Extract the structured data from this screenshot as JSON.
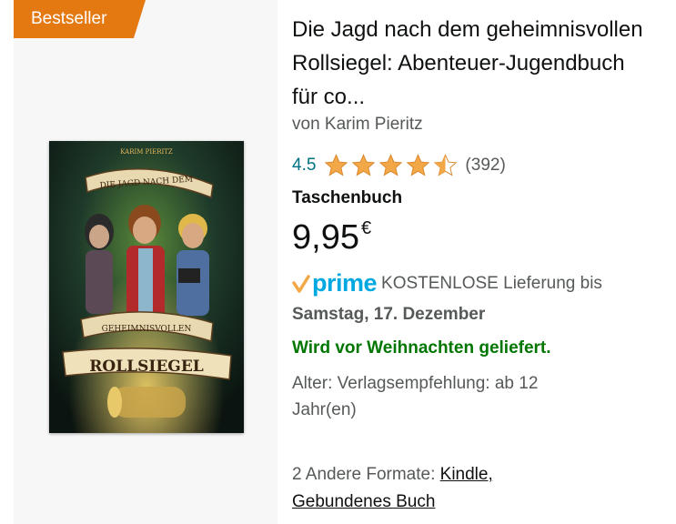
{
  "badge": {
    "label": "Bestseller"
  },
  "product": {
    "cover_image": "book-cover-image",
    "cover": {
      "author": "KARIM PIERITZ",
      "line1": "DIE JAGD NACH DEM",
      "line2": "GEHEIMNISVOLLEN",
      "line3": "ROLLSIEGEL"
    },
    "title": "Die Jagd nach dem geheimnisvollen Rollsiegel: Abenteuer-Jugendbuch für co...",
    "author": "von Karim Pieritz",
    "rating": {
      "value": "4.5",
      "stars": 4.5,
      "review_count": "(392)"
    },
    "format": "Taschenbuch",
    "price": {
      "amount": "9,95",
      "currency": "€"
    },
    "delivery": {
      "prime_label": "prime",
      "free_shipping": "KOSTENLOSE Lieferung bis",
      "date": "Samstag, 17. Dezember"
    },
    "christmas_note": "Wird vor Weihnachten geliefert.",
    "age": "Alter: Verlagsempfehlung: ab 12 Jahr(en)",
    "other_formats": {
      "prefix": "2 Andere Formate:",
      "formats": [
        "Kindle,",
        "Gebundenes Buch"
      ]
    }
  },
  "colors": {
    "badge": "#e47911",
    "star": "#f3a847",
    "link": "#007185",
    "prime": "#00a8e1",
    "green": "#007600"
  }
}
